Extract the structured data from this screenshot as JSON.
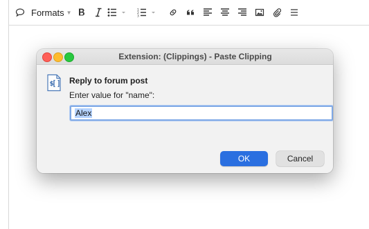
{
  "toolbar": {
    "formats_label": "Formats",
    "buttons": [
      "comment-icon",
      "bold-icon",
      "italic-icon",
      "bulleted-list-icon",
      "numbered-list-icon",
      "link-icon",
      "blockquote-icon",
      "align-left-icon",
      "align-center-icon",
      "align-right-icon",
      "image-icon",
      "attachment-icon",
      "menu-icon"
    ]
  },
  "dialog": {
    "title": "Extension: (Clippings) - Paste Clipping",
    "heading": "Reply to forum post",
    "prompt": "Enter value for \"name\":",
    "input_value": "Alex",
    "ok_label": "OK",
    "cancel_label": "Cancel"
  },
  "colors": {
    "ok_button": "#2a6fe0",
    "input_focus": "#7fa9e6",
    "close_light": "#ff5f57",
    "minimize_light": "#febc2e",
    "maximize_light": "#28c840"
  }
}
